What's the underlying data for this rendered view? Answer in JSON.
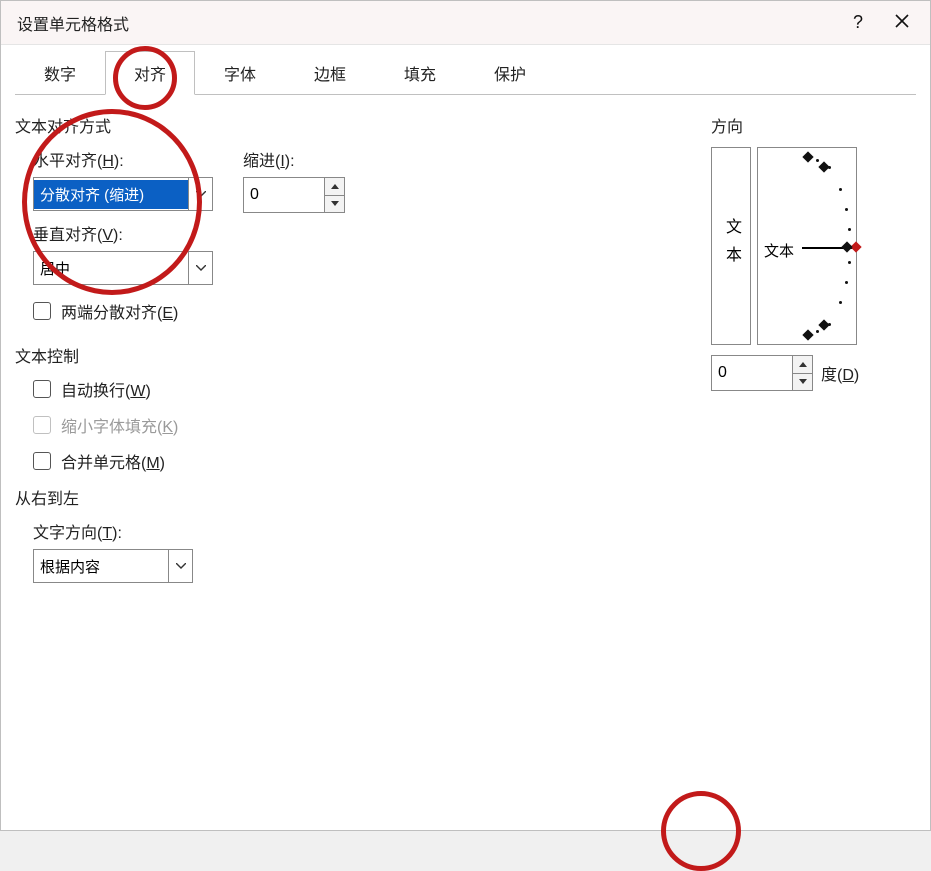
{
  "dialog": {
    "title": "设置单元格格式"
  },
  "tabs": {
    "number": "数字",
    "alignment": "对齐",
    "font": "字体",
    "border": "边框",
    "fill": "填充",
    "protection": "保护"
  },
  "alignment": {
    "section": "文本对齐方式",
    "horizontal_label_pre": "水平对齐(",
    "horizontal_key": "H",
    "horizontal_label_post": "):",
    "horizontal_value": "分散对齐 (缩进)",
    "vertical_label_pre": "垂直对齐(",
    "vertical_key": "V",
    "vertical_label_post": "):",
    "vertical_value": "居中",
    "indent_label_pre": "缩进(",
    "indent_key": "I",
    "indent_label_post": "):",
    "indent_value": "0",
    "justify_label_pre": "两端分散对齐(",
    "justify_key": "E",
    "justify_label_post": ")"
  },
  "textcontrol": {
    "section": "文本控制",
    "wrap_pre": "自动换行(",
    "wrap_key": "W",
    "wrap_post": ")",
    "shrink_pre": "缩小字体填充(",
    "shrink_key": "K",
    "shrink_post": ")",
    "merge_pre": "合并单元格(",
    "merge_key": "M",
    "merge_post": ")"
  },
  "rtl": {
    "section": "从右到左",
    "dir_label_pre": "文字方向(",
    "dir_key": "T",
    "dir_label_post": "):",
    "dir_value": "根据内容"
  },
  "orientation": {
    "section": "方向",
    "vertical_text": "文本",
    "dial_text": "文本",
    "degree_value": "0",
    "degree_label_pre": "度(",
    "degree_key": "D",
    "degree_label_post": ")"
  }
}
